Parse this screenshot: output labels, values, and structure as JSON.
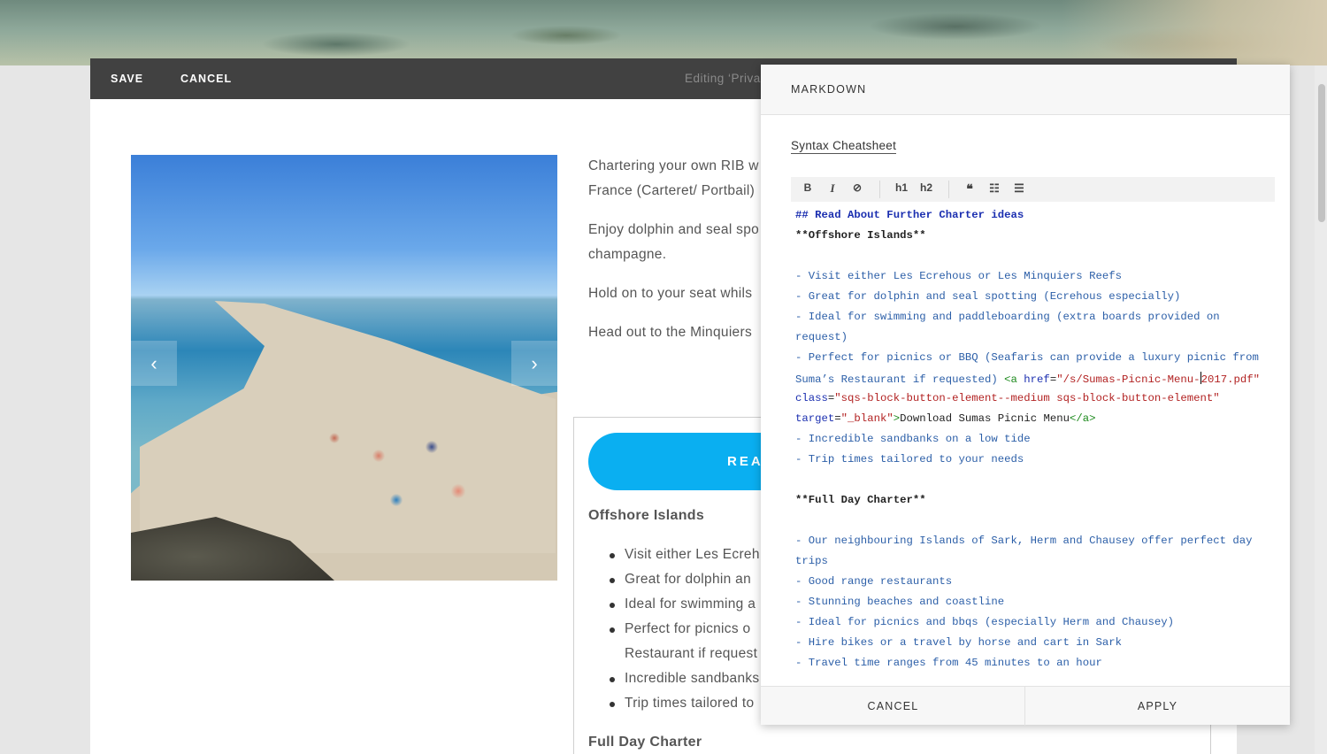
{
  "editor_bar": {
    "save": "SAVE",
    "cancel": "CANCEL",
    "editing_title": "Editing ‘Private Groups’"
  },
  "content": {
    "paragraphs": [
      "Chartering your own RIB w",
      "France (Carteret/ Portbail)",
      "Enjoy dolphin and seal spo",
      "champagne.",
      "Hold on to your seat whils",
      "Head out to the Minquiers"
    ],
    "button_label": "READ",
    "section1_title": "Offshore Islands",
    "bullets": [
      "Visit either Les Ecreh",
      "Great for dolphin an",
      "Ideal for swimming a",
      "Perfect for picnics o",
      "Restaurant if request",
      "Incredible sandbanks",
      "Trip times tailored to"
    ],
    "section2_title": "Full Day Charter"
  },
  "gallery": {
    "prev_icon": "chevron-left-icon",
    "next_icon": "chevron-right-icon",
    "prev_glyph": "‹",
    "next_glyph": "›"
  },
  "markdown_panel": {
    "title": "MARKDOWN",
    "cheatsheet_link": "Syntax Cheatsheet",
    "toolbar": {
      "bold": "B",
      "italic": "I",
      "link_glyph": "⊘",
      "h1": "h1",
      "h2": "h2",
      "quote_glyph": "❝",
      "ul_glyph": "☷",
      "ol_glyph": "☰"
    },
    "code_lines": {
      "l1": "## Read About Further Charter ideas",
      "l2": "**Offshore Islands**",
      "l4": "- Visit either Les Ecrehous or Les Minquiers Reefs",
      "l5": "- Great for dolphin and seal spotting (Ecrehous especially)",
      "l6": "- Ideal for swimming and paddleboarding (extra boards provided on",
      "l7": "request)",
      "l8": "- Perfect for picnics or BBQ (Seafaris can provide a luxury picnic from",
      "l9_text": "Suma’s Restaurant if requested) ",
      "l9_tag": "<a ",
      "l9_attr": "href",
      "l9_eq": "=",
      "l9_str1": "\"/s/Sumas-Picnic-Menu-",
      "l9_str2": "2017.pdf\"",
      "l10_attr": "class",
      "l10_eq": "=",
      "l10_str": "\"sqs-block-button-element--medium sqs-block-button-element\"",
      "l11_attr": "target",
      "l11_eq": "=",
      "l11_str": "\"_blank\"",
      "l11_tag1": ">",
      "l11_text": "Download Sumas Picnic Menu",
      "l11_tag2": "</a>",
      "l12": "- Incredible sandbanks on a low tide",
      "l13": "- Trip times tailored to your needs",
      "l15": "**Full Day Charter**",
      "l17": "- Our neighbouring Islands of Sark, Herm and Chausey offer perfect day",
      "l18": "trips",
      "l19": "- Good range restaurants",
      "l20": "- Stunning beaches and coastline",
      "l21": "- Ideal for picnics and bbqs (especially Herm and Chausey)",
      "l22": "- Hire bikes or a travel by horse and cart in Sark",
      "l23": "- Travel time ranges from 45 minutes to an hour"
    },
    "footer": {
      "cancel": "CANCEL",
      "apply": "APPLY"
    }
  },
  "colors": {
    "toolbar_bg": "#414141",
    "button_blue": "#0aaff1",
    "code_blue": "#2c5fa8"
  }
}
